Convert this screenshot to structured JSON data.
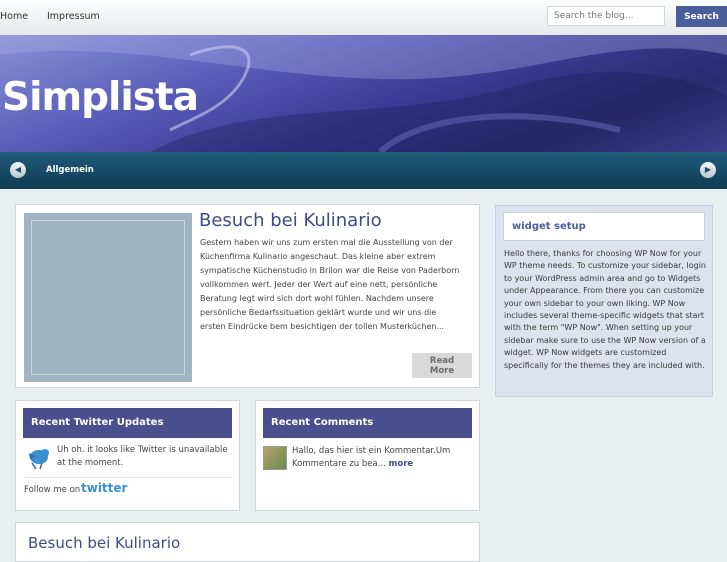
{
  "nav": {
    "home": "Home",
    "impressum": "Impressum"
  },
  "search": {
    "placeholder": "Search the blog...",
    "button": "Search"
  },
  "header": {
    "logo": "Simplista"
  },
  "category_bar": {
    "label": "Allgemein",
    "prev_icon": "arrow-left-icon",
    "next_icon": "arrow-right-icon"
  },
  "featured_post": {
    "title": "Besuch bei Kulinario",
    "excerpt": "Gestern haben wir uns zum ersten mal die Ausstellung von der Küchenfirma Kulinario angeschaut. Das kleine aber extrem sympatische Küchenstudio in Brilon war die Reise von Paderborn vollkommen wert. Jeder der Wert auf eine nett, persönliche Beratung legt wird sich dort wohl fühlen. Nachdem unsere persönliche Bedarfssituation geklärt wurde und wir uns die ersten Eindrücke bem besichtigen der tollen Musterküchen...",
    "read_more": "Read More"
  },
  "twitter": {
    "title": "Recent Twitter Updates",
    "message": "Uh oh. it looks like Twitter is unavailable at the moment.",
    "follow": "Follow me on",
    "follow_brand": "twitter"
  },
  "comments": {
    "title": "Recent Comments",
    "text": "Hallo, das hier ist ein Kommentar.Um Kommentare zu bea...",
    "more": "more"
  },
  "widget": {
    "title": "widget setup",
    "text": "Hello there, thanks for choosing WP Now for your WP theme needs. To customize your sidebar, login to your WordPress admin area and go to Widgets under Appearance. From there you can customize your own sidebar to your own liking. WP Now includes several theme-specific widgets that start with the term \"WP Now\". When setting up your sidebar make sure to use the WP Now version of a widget. WP Now widgets are customized specifically for the themes they are included with."
  },
  "second_post": {
    "title": "Besuch bei Kulinario"
  },
  "colors": {
    "accent": "#4a4f8e",
    "catbar": "#0f3c55",
    "title": "#3e4a8a"
  }
}
